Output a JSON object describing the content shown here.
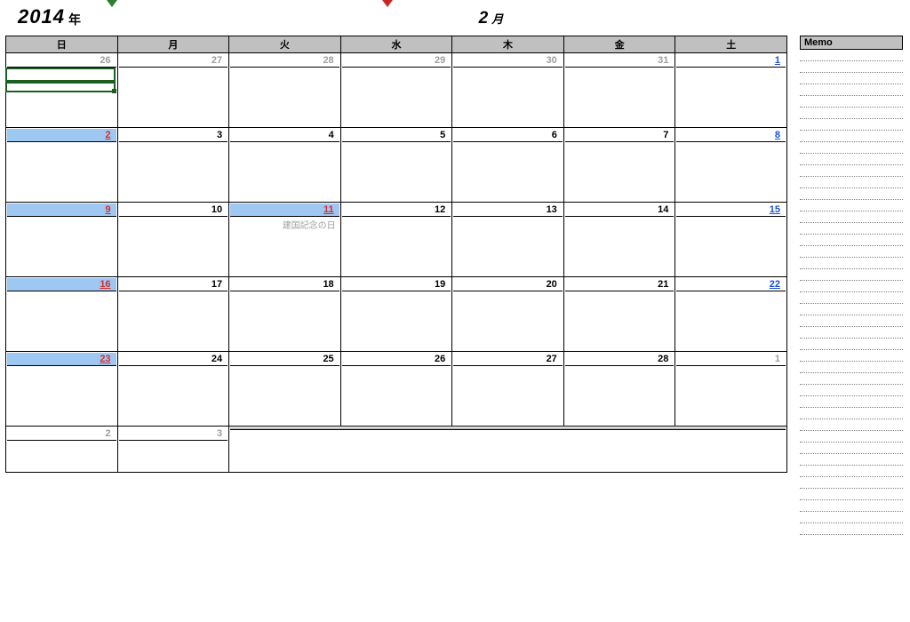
{
  "header": {
    "year": "2014",
    "year_suffix": "年",
    "month": "2",
    "month_suffix": "月"
  },
  "dow": [
    "日",
    "月",
    "火",
    "水",
    "木",
    "金",
    "土"
  ],
  "memo_title": "Memo",
  "weeks": [
    {
      "last": false,
      "days": [
        {
          "num": "26",
          "cls": "other"
        },
        {
          "num": "27",
          "cls": "other"
        },
        {
          "num": "28",
          "cls": "other"
        },
        {
          "num": "29",
          "cls": "other"
        },
        {
          "num": "30",
          "cls": "other"
        },
        {
          "num": "31",
          "cls": "other"
        },
        {
          "num": "1",
          "cls": "sat",
          "event": ""
        }
      ]
    },
    {
      "last": false,
      "days": [
        {
          "num": "2",
          "cls": "sun hl"
        },
        {
          "num": "3",
          "cls": ""
        },
        {
          "num": "4",
          "cls": ""
        },
        {
          "num": "5",
          "cls": ""
        },
        {
          "num": "6",
          "cls": ""
        },
        {
          "num": "7",
          "cls": ""
        },
        {
          "num": "8",
          "cls": "sat"
        }
      ]
    },
    {
      "last": false,
      "days": [
        {
          "num": "9",
          "cls": "sun hl"
        },
        {
          "num": "10",
          "cls": ""
        },
        {
          "num": "11",
          "cls": "holiday hl",
          "event": "建国記念の日"
        },
        {
          "num": "12",
          "cls": ""
        },
        {
          "num": "13",
          "cls": ""
        },
        {
          "num": "14",
          "cls": ""
        },
        {
          "num": "15",
          "cls": "sat"
        }
      ]
    },
    {
      "last": false,
      "days": [
        {
          "num": "16",
          "cls": "sun hl"
        },
        {
          "num": "17",
          "cls": ""
        },
        {
          "num": "18",
          "cls": ""
        },
        {
          "num": "19",
          "cls": ""
        },
        {
          "num": "20",
          "cls": ""
        },
        {
          "num": "21",
          "cls": ""
        },
        {
          "num": "22",
          "cls": "sat"
        }
      ]
    },
    {
      "last": false,
      "days": [
        {
          "num": "23",
          "cls": "sun hl"
        },
        {
          "num": "24",
          "cls": ""
        },
        {
          "num": "25",
          "cls": ""
        },
        {
          "num": "26",
          "cls": ""
        },
        {
          "num": "27",
          "cls": ""
        },
        {
          "num": "28",
          "cls": ""
        },
        {
          "num": "1",
          "cls": "other"
        }
      ]
    },
    {
      "last": true,
      "days": [
        {
          "num": "2",
          "cls": "other"
        },
        {
          "num": "3",
          "cls": "other"
        },
        {
          "num": "",
          "cls": "greyhead",
          "colspan": 5
        }
      ]
    }
  ]
}
